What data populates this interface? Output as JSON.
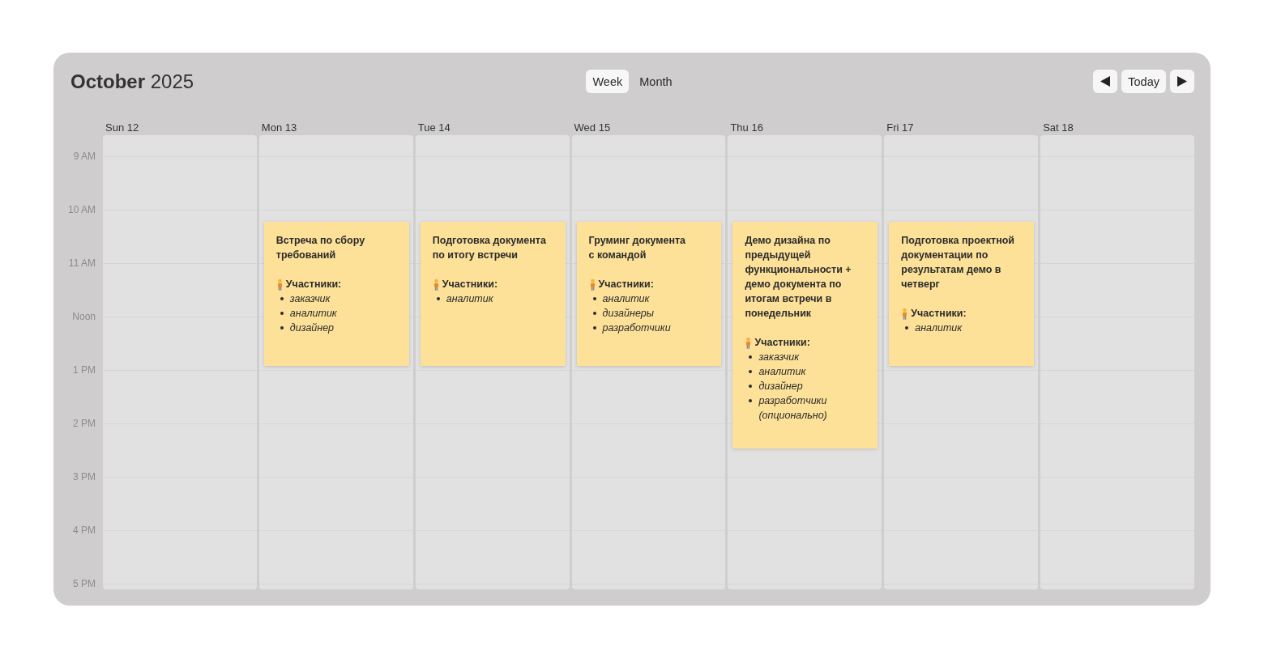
{
  "header": {
    "title": "**October** 2025",
    "view_switcher": [
      {
        "label": "Week",
        "selected": true
      },
      {
        "label": "Month",
        "selected": false
      }
    ],
    "navigation": {
      "today_label": "Today"
    }
  },
  "week": {
    "time_labels": [
      "9 AM",
      "10 AM",
      "11 AM",
      "Noon",
      "1 PM",
      "2 PM",
      "3 PM",
      "4 PM",
      "5 PM"
    ],
    "days": [
      {
        "label": "Sun 12"
      },
      {
        "label": "Mon 13",
        "events": [
          {
            "title": "Встреча по сбору требований",
            "participants_heading": "Участники:",
            "participants": [
              "заказчик",
              "аналитик",
              "дизайнер"
            ]
          }
        ]
      },
      {
        "label": "Tue 14",
        "events": [
          {
            "title": "Подготовка документа по итогу встречи",
            "participants_heading": "Участники:",
            "participants": [
              "аналитик"
            ]
          }
        ]
      },
      {
        "label": "Wed 15",
        "events": [
          {
            "title": "Груминг документа с командой",
            "participants_heading": "Участники:",
            "participants": [
              "аналитик",
              "дизайнеры",
              "разработчики"
            ]
          }
        ]
      },
      {
        "label": "Thu 16",
        "events": [
          {
            "title": "Демо дизайна по предыдущей функциональности + демо документа по итогам встречи в понедельник",
            "participants_heading": "Участники:",
            "participants": [
              "заказчик",
              "аналитик",
              "дизайнер",
              "разработчики (опционально)"
            ]
          }
        ]
      },
      {
        "label": "Fri 17",
        "events": [
          {
            "title": "Подготовка проектной документации по результатам демо в четверг",
            "participants_heading": "Участники:",
            "participants": [
              "аналитик"
            ]
          }
        ]
      },
      {
        "label": "Sat 18"
      }
    ]
  }
}
